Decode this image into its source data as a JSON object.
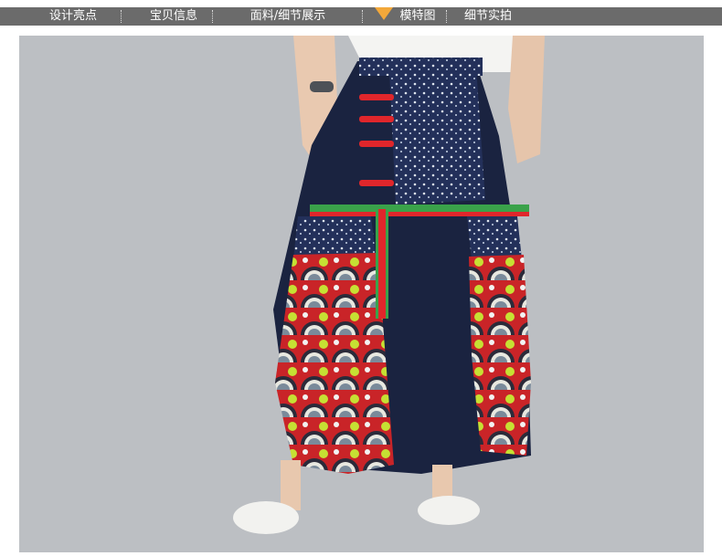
{
  "nav": {
    "items": [
      {
        "label": "设计亮点"
      },
      {
        "label": "宝贝信息"
      },
      {
        "label": "面料/细节展示"
      },
      {
        "label": "模特图"
      },
      {
        "label": "细节实拍"
      }
    ],
    "active_index": 3
  },
  "colors": {
    "nav_bg": "#6b6b6b",
    "active_marker": "#f3a83a",
    "skirt_navy": "#1a2340",
    "toggle_red": "#e0262b",
    "band_green": "#3aa24a",
    "backdrop": "#b9bcc0"
  },
  "icons": {
    "active_marker": "triangle-down-icon"
  }
}
